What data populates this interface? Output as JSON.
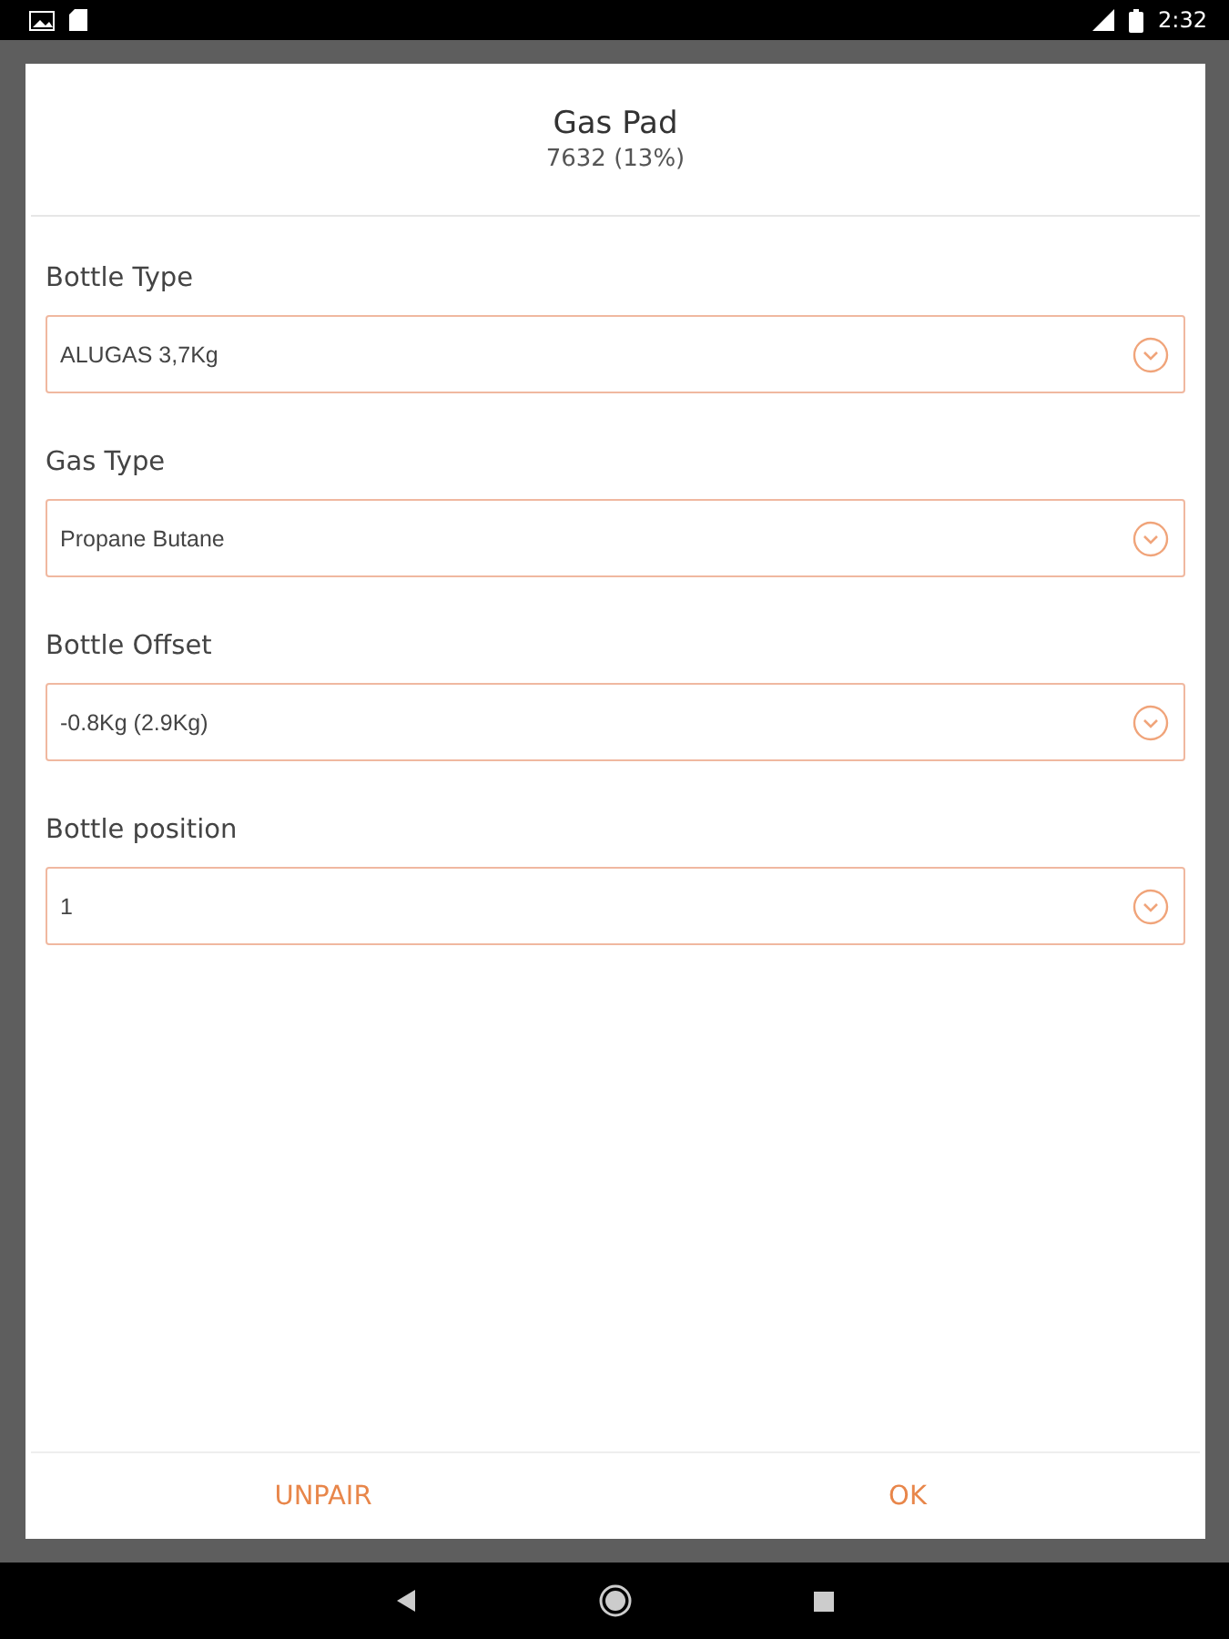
{
  "status_bar": {
    "time": "2:32"
  },
  "dialog": {
    "title": "Gas Pad",
    "subtitle": "7632   (13%)",
    "fields": [
      {
        "label": "Bottle Type",
        "value": "ALUGAS 3,7Kg"
      },
      {
        "label": "Gas Type",
        "value": "Propane Butane"
      },
      {
        "label": "Bottle Offset",
        "value": "-0.8Kg (2.9Kg)"
      },
      {
        "label": "Bottle position",
        "value": "1"
      }
    ],
    "buttons": [
      "UNPAIR",
      "OK"
    ]
  }
}
